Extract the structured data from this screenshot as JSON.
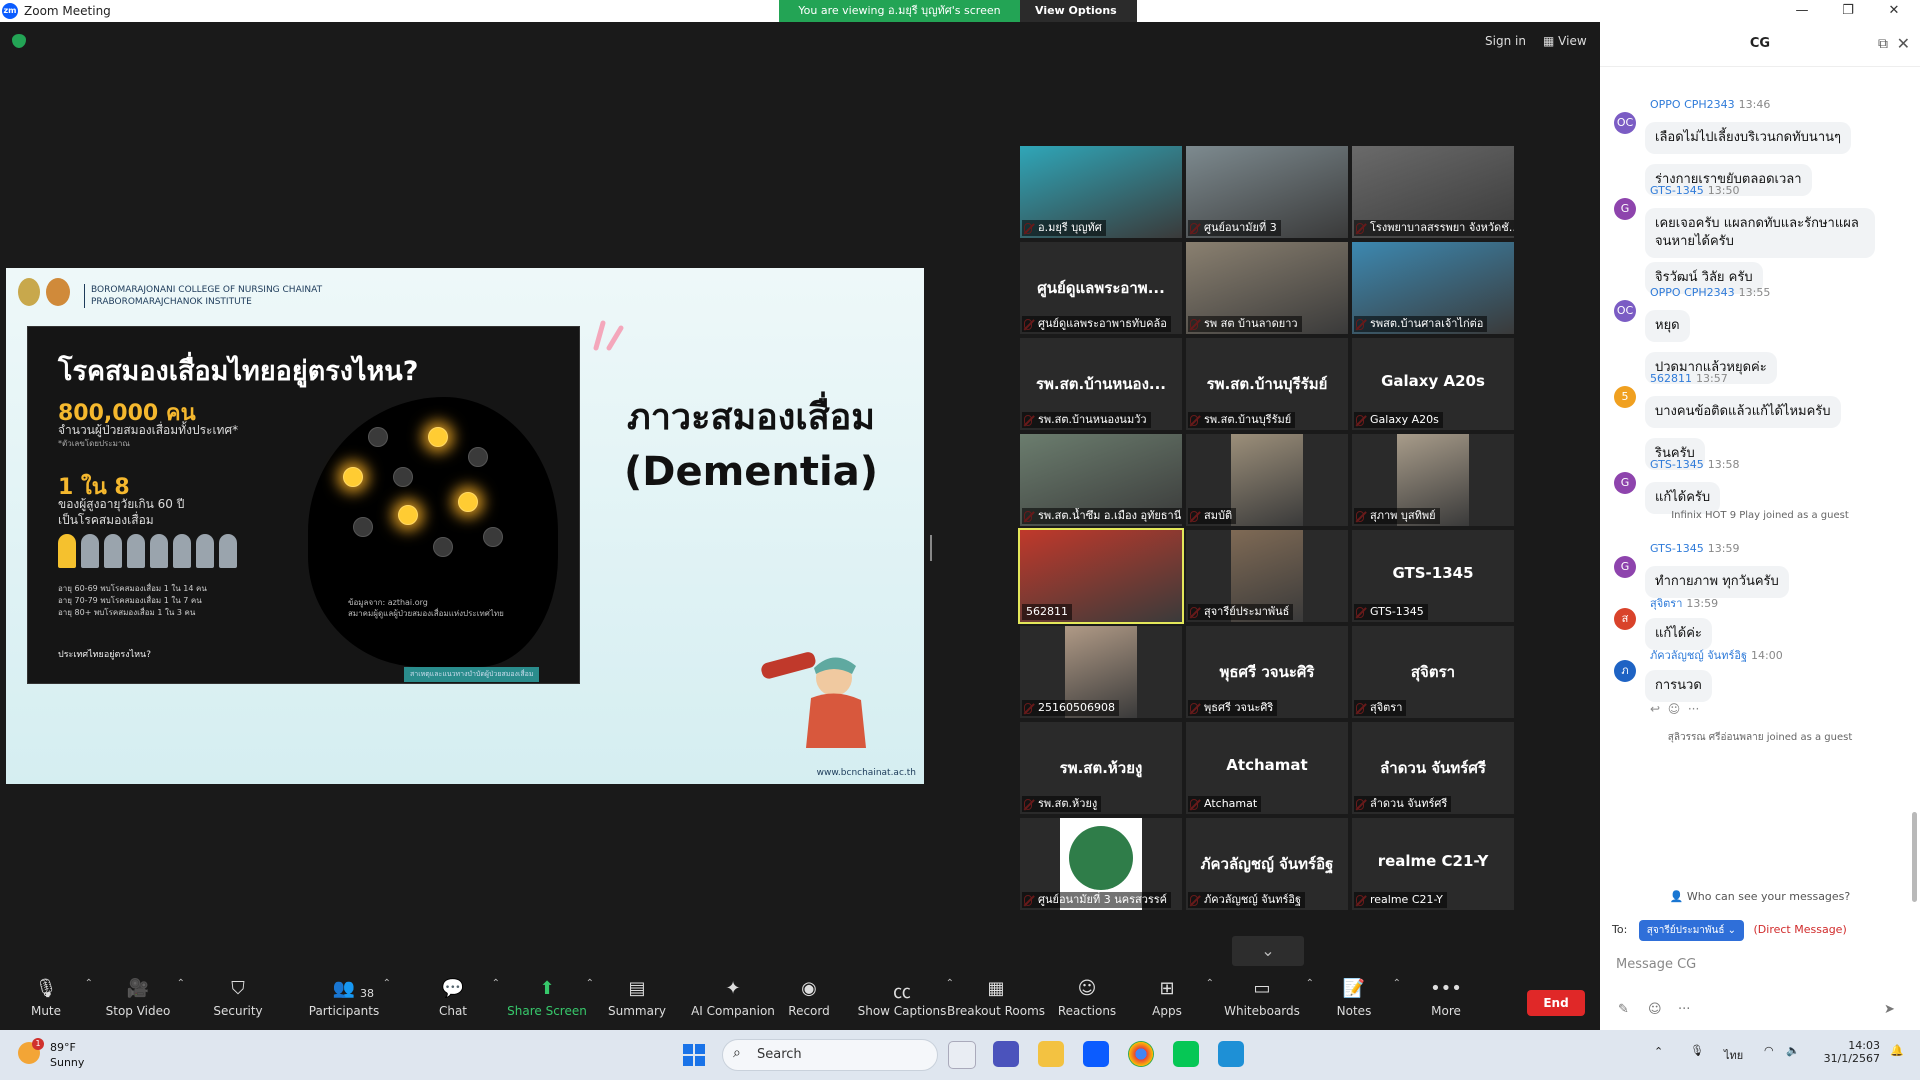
{
  "window": {
    "title": "Zoom Meeting",
    "viewing_banner": "You are viewing อ.มยุรี บุญทัศ's screen",
    "view_options": "View Options",
    "sign_in": "Sign in",
    "view": "View"
  },
  "slide": {
    "college_line1": "BOROMARAJONANI COLLEGE OF NURSING CHAINAT",
    "college_line2": "PRABOROMARAJCHANOK INSTITUTE",
    "title_line1": "ภาวะสมองเสื่อม",
    "title_line2": "(Dementia)",
    "url": "www.bcnchainat.ac.th",
    "infographic": {
      "question": "โรคสมองเสื่อมไทยอยู่ตรงไหน?",
      "big_number": "800,000 คน",
      "sub1": "จำนวนผู้ป่วยสมองเสื่อมทั้งประเทศ*",
      "sub1_note": "*ตัวเลขโดยประมาณ",
      "ratio": "1 ใน 8",
      "sub2": "ของผู้สูงอายุวัยเกิน 60 ปี",
      "sub3": "เป็นโรคสมองเสื่อม",
      "ages": [
        "อายุ 60-69 พบโรคสมองเสื่อม 1 ใน 14 คน",
        "อายุ 70-79 พบโรคสมองเสื่อม 1 ใน 7 คน",
        "อายุ 80+ พบโรคสมองเสื่อม 1 ใน 3 คน"
      ],
      "source_line1": "ข้อมูลจาก: azthai.org",
      "source_line2": "สมาคมผู้ดูแลผู้ป่วยสมองเสื่อมแห่งประเทศไทย",
      "where": "ประเทศไทยอยู่ตรงไหน?",
      "footer": "สาเหตุและแนวทางบำบัดผู้ป่วยสมองเสื่อม"
    }
  },
  "gallery": {
    "tiles": [
      {
        "label": "อ.มยุรี บุญทัศ",
        "video": true,
        "center": ""
      },
      {
        "label": "ศูนย์อนามัยที่ 3",
        "video": true,
        "center": ""
      },
      {
        "label": "โรงพยาบาลสรรพยา จังหวัดชัยนาท",
        "video": true,
        "center": ""
      },
      {
        "label": "ศูนย์ดูแลพระอาพาธทับคล้อ",
        "video": false,
        "center": "ศูนย์ดูแลพระอาพ..."
      },
      {
        "label": "รพ สต บ้านลาดยาว",
        "video": true,
        "center": ""
      },
      {
        "label": "รพสต.บ้านศาลเจ้าไก่ต่อ",
        "video": true,
        "center": ""
      },
      {
        "label": "รพ.สต.บ้านหนองนมวัว",
        "video": false,
        "center": "รพ.สต.บ้านหนอง..."
      },
      {
        "label": "รพ.สต.บ้านบุรีรัมย์",
        "video": false,
        "center": "รพ.สต.บ้านบุรีรัมย์"
      },
      {
        "label": "Galaxy A20s",
        "video": false,
        "center": "Galaxy A20s"
      },
      {
        "label": "รพ.สต.น้ำซึม อ.เมือง อุทัยธานี",
        "video": true,
        "center": ""
      },
      {
        "label": "สมบัติ",
        "video": true,
        "center": ""
      },
      {
        "label": "สุภาพ บุสทิพย์",
        "video": true,
        "center": ""
      },
      {
        "label": "562811",
        "video": true,
        "center": ""
      },
      {
        "label": "สุจารีย์ประมาพันธ์",
        "video": true,
        "center": ""
      },
      {
        "label": "GTS-1345",
        "video": false,
        "center": "GTS-1345"
      },
      {
        "label": "25160506908",
        "video": true,
        "center": ""
      },
      {
        "label": "พุธศรี วจนะศิริ",
        "video": false,
        "center": "พุธศรี วจนะศิริ"
      },
      {
        "label": "สุจิตรา",
        "video": false,
        "center": "สุจิตรา"
      },
      {
        "label": "รพ.สต.ห้วยงู",
        "video": false,
        "center": "รพ.สต.ห้วยงู"
      },
      {
        "label": "Atchamat",
        "video": false,
        "center": "Atchamat"
      },
      {
        "label": "ลำดวน จันทร์ศรี",
        "video": false,
        "center": "ลำดวน จันทร์ศรี"
      },
      {
        "label": "ศูนย์อนามัยที่ 3 นครสวรรค์",
        "video": true,
        "center": ""
      },
      {
        "label": "ภัควลัญชญ์ จันทร์อิฐ",
        "video": false,
        "center": "ภัควลัญชญ์ จันทร์อิฐ"
      },
      {
        "label": "realme C21-Y",
        "video": false,
        "center": "realme C21-Y"
      }
    ]
  },
  "toolbar": {
    "mute": "Mute",
    "stop_video": "Stop Video",
    "security": "Security",
    "participants": "Participants",
    "participants_count": "38",
    "chat": "Chat",
    "share_screen": "Share Screen",
    "summary": "Summary",
    "ai_companion": "AI Companion",
    "record": "Record",
    "show_captions": "Show Captions",
    "breakout_rooms": "Breakout Rooms",
    "reactions": "Reactions",
    "apps": "Apps",
    "whiteboards": "Whiteboards",
    "notes": "Notes",
    "more": "More",
    "end": "End"
  },
  "chat": {
    "title": "CG",
    "messages": [
      {
        "sender": "OPPO CPH2343",
        "time": "13:46",
        "avatar": "OC",
        "color": "#7b5cc4",
        "texts": [
          "เลือดไม่ไปเลี้ยงบริเวนกดทับนานๆ",
          "ร่างกายเราขยับตลอดเวลา"
        ]
      },
      {
        "sender": "GTS-1345",
        "time": "13:50",
        "avatar": "G",
        "color": "#8e44ad",
        "texts": [
          "เคยเจอครับ แผลกดทับและรักษาแผลจนหายได้ครับ",
          "จิรวัฒน์ วิลัย ครับ"
        ]
      },
      {
        "sender": "OPPO CPH2343",
        "time": "13:55",
        "avatar": "OC",
        "color": "#7b5cc4",
        "texts": [
          "หยุด",
          "ปวดมากแล้วหยุดค่ะ"
        ]
      },
      {
        "sender": "562811",
        "time": "13:57",
        "avatar": "5",
        "color": "#f0a020",
        "texts": [
          "บางคนข้อติดแล้วแก้ได้ไหมครับ",
          "รินครับ"
        ]
      },
      {
        "sender": "GTS-1345",
        "time": "13:58",
        "avatar": "G",
        "color": "#8e44ad",
        "texts": [
          "แก้ได้ครับ"
        ]
      },
      {
        "sender": "GTS-1345",
        "time": "13:59",
        "avatar": "G",
        "color": "#8e44ad",
        "texts": [
          "ทำกายภาพ ทุกวันครับ"
        ]
      },
      {
        "sender": "สุจิตรา",
        "time": "13:59",
        "avatar": "ส",
        "color": "#d9432b",
        "texts": [
          "แก้ได้ค่ะ"
        ]
      },
      {
        "sender": "ภัควลัญชญ์ จันทร์อิฐ",
        "time": "14:00",
        "avatar": "ภ",
        "color": "#1e63c4",
        "texts": [
          "การนวด"
        ]
      }
    ],
    "system_joined_1": "Infinix HOT 9 Play joined as a guest",
    "system_joined_2": "สุลิวรรณ ศรีอ่อนพลาย joined as a guest",
    "who_can_see": "Who can see your messages?",
    "to_label": "To:",
    "to_recipient": "สุจารีย์ประมาพันธ์",
    "direct_message": "(Direct Message)",
    "input_placeholder": "Message CG"
  },
  "taskbar": {
    "temp": "89°F",
    "condition": "Sunny",
    "weather_badge": "1",
    "search": "Search",
    "lang": "ไทย",
    "time": "14:03",
    "date": "31/1/2567"
  }
}
